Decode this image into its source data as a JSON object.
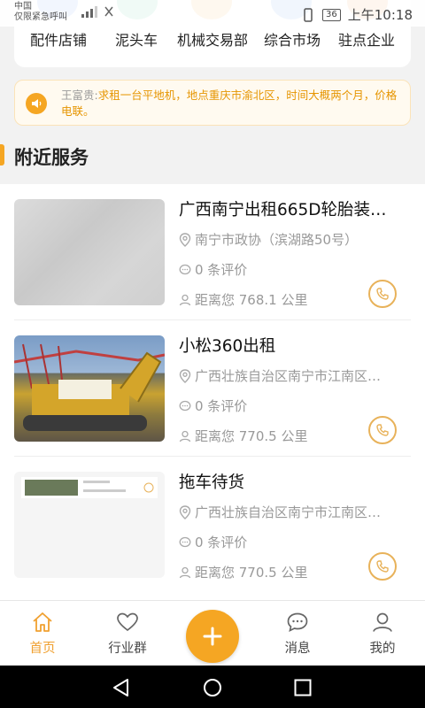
{
  "status_bar": {
    "carrier_line1": "中国",
    "carrier_line2": "仅限紧急呼叫",
    "battery": "36",
    "time": "上午10:18"
  },
  "categories": [
    {
      "label": "配件店铺",
      "color": "#5b8def"
    },
    {
      "label": "泥头车",
      "color": "#3fbf8a"
    },
    {
      "label": "机械交易部",
      "color": "#e9a43a"
    },
    {
      "label": "综合市场",
      "color": "#4a90e2"
    },
    {
      "label": "驻点企业",
      "color": "#f08a3a"
    }
  ],
  "notice": {
    "user": "王富贵:",
    "text": "求租一台平地机，地点重庆市渝北区，时间大概两个月，价格电联。"
  },
  "section_title": "附近服务",
  "services": [
    {
      "title": "广西南宁出租665D轮胎装…",
      "address": "南宁市政协（滨湖路50号）",
      "reviews": "0 条评价",
      "distance": "距离您 768.1 公里"
    },
    {
      "title": "小松360出租",
      "address": "广西壮族自治区南宁市江南区…",
      "reviews": "0 条评价",
      "distance": "距离您 770.5 公里"
    },
    {
      "title": "拖车待货",
      "address": "广西壮族自治区南宁市江南区…",
      "reviews": "0 条评价",
      "distance": "距离您 770.5 公里"
    }
  ],
  "tabbar": {
    "home": "首页",
    "groups": "行业群",
    "messages": "消息",
    "mine": "我的"
  },
  "colors": {
    "accent": "#f5a623",
    "notice_text": "#e69500"
  }
}
